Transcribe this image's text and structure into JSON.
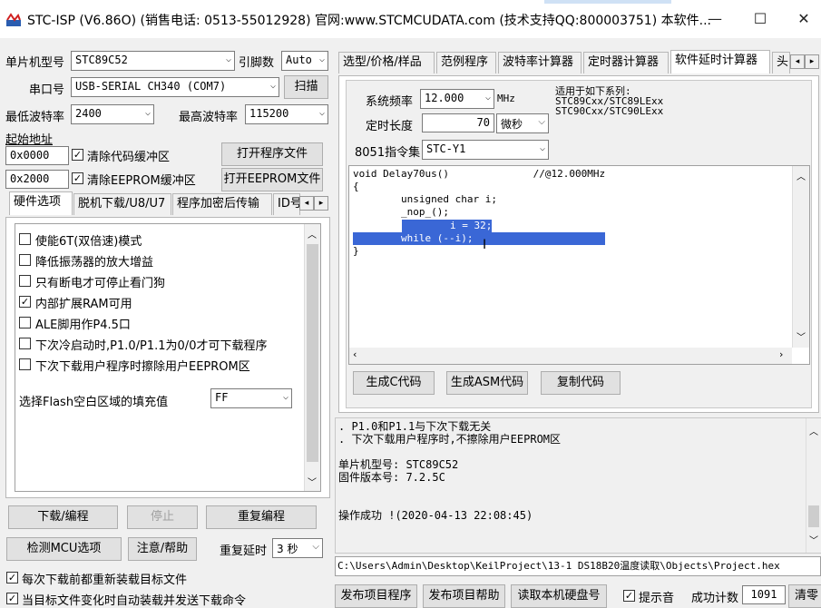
{
  "title": "STC-ISP (V6.86O) (销售电话: 0513-55012928) 官网:www.STCMCUDATA.com  (技术支持QQ:800003751) 本软件...",
  "window_controls": {
    "minimize": "—",
    "maximize": "☐",
    "close": "✕"
  },
  "left": {
    "mcu_type_label": "单片机型号",
    "mcu_type_value": "STC89C52",
    "pin_count_label": "引脚数",
    "pin_count_value": "Auto",
    "port_label": "串口号",
    "port_value": "USB-SERIAL CH340 (COM7)",
    "scan_button": "扫描",
    "min_baud_label": "最低波特率",
    "min_baud_value": "2400",
    "max_baud_label": "最高波特率",
    "max_baud_value": "115200",
    "start_addr_label": "起始地址",
    "addr1": "0x0000",
    "clear_code_label": "清除代码缓冲区",
    "open_program_button": "打开程序文件",
    "addr2": "0x2000",
    "clear_eeprom_label": "清除EEPROM缓冲区",
    "open_eeprom_button": "打开EEPROM文件",
    "tabs": [
      "硬件选项",
      "脱机下载/U8/U7",
      "程序加密后传输",
      "ID号"
    ],
    "options": [
      {
        "label": "使能6T(双倍速)模式",
        "checked": false
      },
      {
        "label": "降低振荡器的放大增益",
        "checked": false
      },
      {
        "label": "只有断电才可停止看门狗",
        "checked": false
      },
      {
        "label": "内部扩展RAM可用",
        "checked": true
      },
      {
        "label": "ALE脚用作P4.5口",
        "checked": false
      },
      {
        "label": "下次冷启动时,P1.0/P1.1为0/0才可下载程序",
        "checked": false
      },
      {
        "label": "下次下载用户程序时擦除用户EEPROM区",
        "checked": false
      }
    ],
    "flash_fill_label": "选择Flash空白区域的填充值",
    "flash_fill_value": "FF",
    "download_button": "下载/编程",
    "stop_button": "停止",
    "reprogram_button": "重复编程",
    "check_mcu_button": "检测MCU选项",
    "help_button": "注意/帮助",
    "repeat_delay_label": "重复延时",
    "repeat_delay_value": "3 秒",
    "reload_label": "每次下载前都重新装载目标文件",
    "auto_send_label": "当目标文件变化时自动装载并发送下载命令"
  },
  "right": {
    "tabs": [
      "选型/价格/样品",
      "范例程序",
      "波特率计算器",
      "定时器计算器",
      "软件延时计算器",
      "头"
    ],
    "active_tab": "软件延时计算器",
    "sys_freq_label": "系统频率",
    "sys_freq_value": "12.000",
    "freq_unit": "MHz",
    "applies_label": "适用于如下系列:",
    "applies_1": "STC89Cxx/STC89LExx",
    "applies_2": "STC90Cxx/STC90LExx",
    "timer_len_label": "定时长度",
    "timer_len_value": "70",
    "timer_unit": "微秒",
    "instr_set_label": "8051指令集",
    "instr_set_value": "STC-Y1",
    "code_lines": [
      "void Delay70us()              //@12.000MHz",
      "{",
      "        unsigned char i;",
      "",
      "        _nop_();",
      "        i = 32;",
      "        while (--i);",
      "}"
    ],
    "gen_c_button": "生成C代码",
    "gen_asm_button": "生成ASM代码",
    "copy_button": "复制代码",
    "log_lines": [
      ". P1.0和P1.1与下次下载无关",
      ". 下次下载用户程序时,不擦除用户EEPROM区",
      "",
      "单片机型号: STC89C52",
      "固件版本号: 7.2.5C",
      "",
      "",
      "操作成功 !(2020-04-13 22:08:45)"
    ],
    "file_path": "C:\\Users\\Admin\\Desktop\\KeilProject\\13-1 DS18B20温度读取\\Objects\\Project.hex",
    "publish_program_button": "发布项目程序",
    "publish_help_button": "发布项目帮助",
    "read_disk_button": "读取本机硬盘号",
    "beep_label": "提示音",
    "success_count_label": "成功计数",
    "success_count_value": "1091",
    "clear_button": "清零"
  }
}
